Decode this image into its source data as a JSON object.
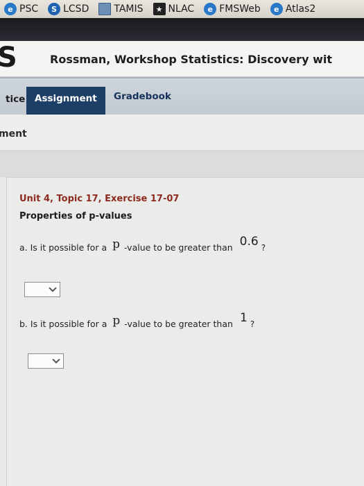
{
  "bookmarks": [
    {
      "label": "PSC",
      "icon": "ie-page-icon"
    },
    {
      "label": "LCSD",
      "icon": "sharepoint-icon"
    },
    {
      "label": "TAMIS",
      "icon": "document-icon"
    },
    {
      "label": "NLAC",
      "icon": "star-icon"
    },
    {
      "label": "FMSWeb",
      "icon": "ie-page-icon"
    },
    {
      "label": "Atlas2",
      "icon": "ie-page-icon"
    }
  ],
  "header": {
    "logo": "S",
    "course_title": "Rossman, Workshop Statistics: Discovery wit"
  },
  "tabs": {
    "practice": "tice",
    "assignment": "Assignment",
    "gradebook": "Gradebook"
  },
  "section": {
    "label": "ment"
  },
  "exercise": {
    "title": "Unit 4, Topic 17, Exercise 17-07",
    "subtitle": "Properties of p-values",
    "questions": [
      {
        "prefix": "a. Is it possible for a",
        "var": "p",
        "middle": "-value to be greater than",
        "value": "0.6",
        "suffix": "?",
        "answer": ""
      },
      {
        "prefix": "b. Is it possible for a",
        "var": "p",
        "middle": "-value to be greater than",
        "value": "1",
        "suffix": "?",
        "answer": ""
      }
    ]
  },
  "colors": {
    "assignment_tab": "#1d3e66",
    "exercise_title": "#8c2a1f"
  }
}
